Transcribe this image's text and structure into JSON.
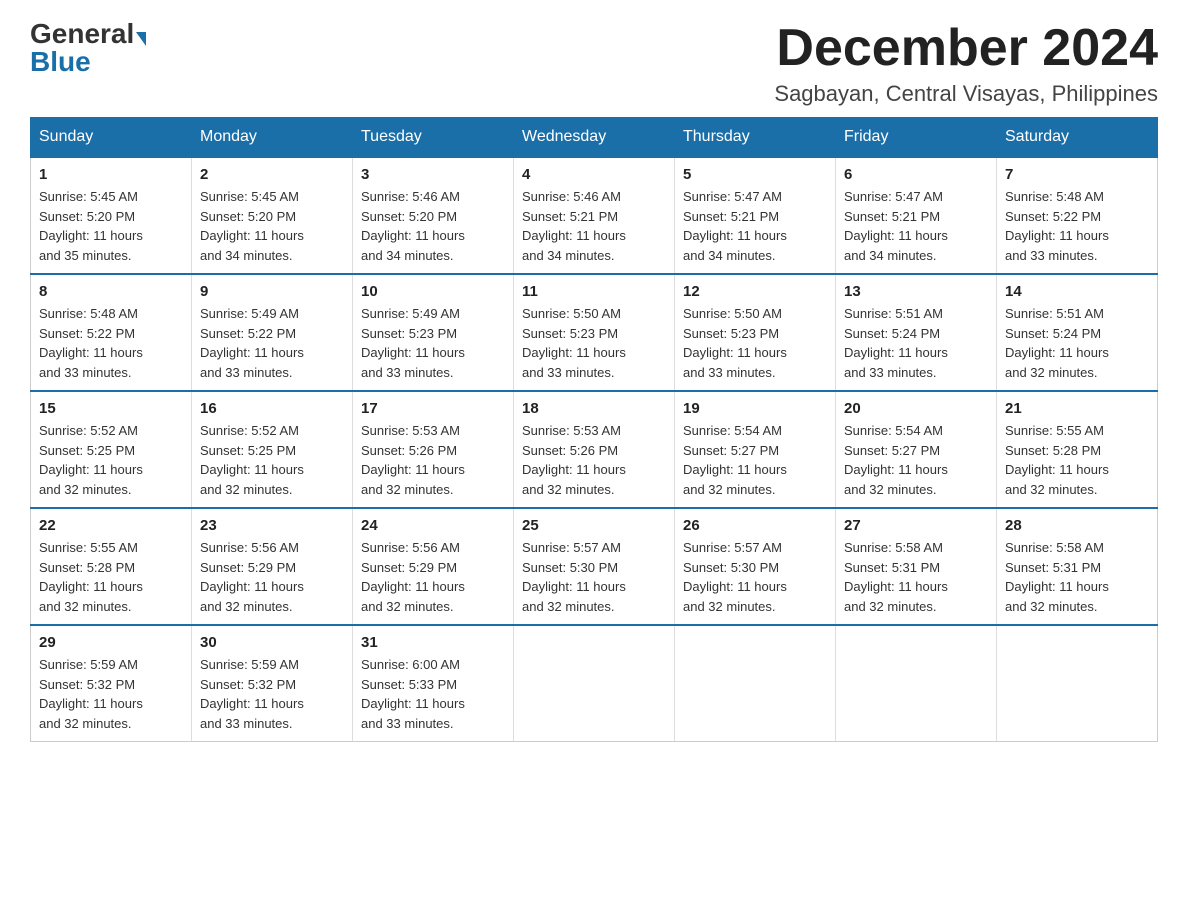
{
  "header": {
    "logo_general": "General",
    "logo_blue": "Blue",
    "month_title": "December 2024",
    "location": "Sagbayan, Central Visayas, Philippines"
  },
  "days_of_week": [
    "Sunday",
    "Monday",
    "Tuesday",
    "Wednesday",
    "Thursday",
    "Friday",
    "Saturday"
  ],
  "weeks": [
    [
      {
        "day": "1",
        "sunrise": "5:45 AM",
        "sunset": "5:20 PM",
        "daylight": "11 hours and 35 minutes."
      },
      {
        "day": "2",
        "sunrise": "5:45 AM",
        "sunset": "5:20 PM",
        "daylight": "11 hours and 34 minutes."
      },
      {
        "day": "3",
        "sunrise": "5:46 AM",
        "sunset": "5:20 PM",
        "daylight": "11 hours and 34 minutes."
      },
      {
        "day": "4",
        "sunrise": "5:46 AM",
        "sunset": "5:21 PM",
        "daylight": "11 hours and 34 minutes."
      },
      {
        "day": "5",
        "sunrise": "5:47 AM",
        "sunset": "5:21 PM",
        "daylight": "11 hours and 34 minutes."
      },
      {
        "day": "6",
        "sunrise": "5:47 AM",
        "sunset": "5:21 PM",
        "daylight": "11 hours and 34 minutes."
      },
      {
        "day": "7",
        "sunrise": "5:48 AM",
        "sunset": "5:22 PM",
        "daylight": "11 hours and 33 minutes."
      }
    ],
    [
      {
        "day": "8",
        "sunrise": "5:48 AM",
        "sunset": "5:22 PM",
        "daylight": "11 hours and 33 minutes."
      },
      {
        "day": "9",
        "sunrise": "5:49 AM",
        "sunset": "5:22 PM",
        "daylight": "11 hours and 33 minutes."
      },
      {
        "day": "10",
        "sunrise": "5:49 AM",
        "sunset": "5:23 PM",
        "daylight": "11 hours and 33 minutes."
      },
      {
        "day": "11",
        "sunrise": "5:50 AM",
        "sunset": "5:23 PM",
        "daylight": "11 hours and 33 minutes."
      },
      {
        "day": "12",
        "sunrise": "5:50 AM",
        "sunset": "5:23 PM",
        "daylight": "11 hours and 33 minutes."
      },
      {
        "day": "13",
        "sunrise": "5:51 AM",
        "sunset": "5:24 PM",
        "daylight": "11 hours and 33 minutes."
      },
      {
        "day": "14",
        "sunrise": "5:51 AM",
        "sunset": "5:24 PM",
        "daylight": "11 hours and 32 minutes."
      }
    ],
    [
      {
        "day": "15",
        "sunrise": "5:52 AM",
        "sunset": "5:25 PM",
        "daylight": "11 hours and 32 minutes."
      },
      {
        "day": "16",
        "sunrise": "5:52 AM",
        "sunset": "5:25 PM",
        "daylight": "11 hours and 32 minutes."
      },
      {
        "day": "17",
        "sunrise": "5:53 AM",
        "sunset": "5:26 PM",
        "daylight": "11 hours and 32 minutes."
      },
      {
        "day": "18",
        "sunrise": "5:53 AM",
        "sunset": "5:26 PM",
        "daylight": "11 hours and 32 minutes."
      },
      {
        "day": "19",
        "sunrise": "5:54 AM",
        "sunset": "5:27 PM",
        "daylight": "11 hours and 32 minutes."
      },
      {
        "day": "20",
        "sunrise": "5:54 AM",
        "sunset": "5:27 PM",
        "daylight": "11 hours and 32 minutes."
      },
      {
        "day": "21",
        "sunrise": "5:55 AM",
        "sunset": "5:28 PM",
        "daylight": "11 hours and 32 minutes."
      }
    ],
    [
      {
        "day": "22",
        "sunrise": "5:55 AM",
        "sunset": "5:28 PM",
        "daylight": "11 hours and 32 minutes."
      },
      {
        "day": "23",
        "sunrise": "5:56 AM",
        "sunset": "5:29 PM",
        "daylight": "11 hours and 32 minutes."
      },
      {
        "day": "24",
        "sunrise": "5:56 AM",
        "sunset": "5:29 PM",
        "daylight": "11 hours and 32 minutes."
      },
      {
        "day": "25",
        "sunrise": "5:57 AM",
        "sunset": "5:30 PM",
        "daylight": "11 hours and 32 minutes."
      },
      {
        "day": "26",
        "sunrise": "5:57 AM",
        "sunset": "5:30 PM",
        "daylight": "11 hours and 32 minutes."
      },
      {
        "day": "27",
        "sunrise": "5:58 AM",
        "sunset": "5:31 PM",
        "daylight": "11 hours and 32 minutes."
      },
      {
        "day": "28",
        "sunrise": "5:58 AM",
        "sunset": "5:31 PM",
        "daylight": "11 hours and 32 minutes."
      }
    ],
    [
      {
        "day": "29",
        "sunrise": "5:59 AM",
        "sunset": "5:32 PM",
        "daylight": "11 hours and 32 minutes."
      },
      {
        "day": "30",
        "sunrise": "5:59 AM",
        "sunset": "5:32 PM",
        "daylight": "11 hours and 33 minutes."
      },
      {
        "day": "31",
        "sunrise": "6:00 AM",
        "sunset": "5:33 PM",
        "daylight": "11 hours and 33 minutes."
      },
      null,
      null,
      null,
      null
    ]
  ],
  "labels": {
    "sunrise": "Sunrise: ",
    "sunset": "Sunset: ",
    "daylight": "Daylight: "
  }
}
